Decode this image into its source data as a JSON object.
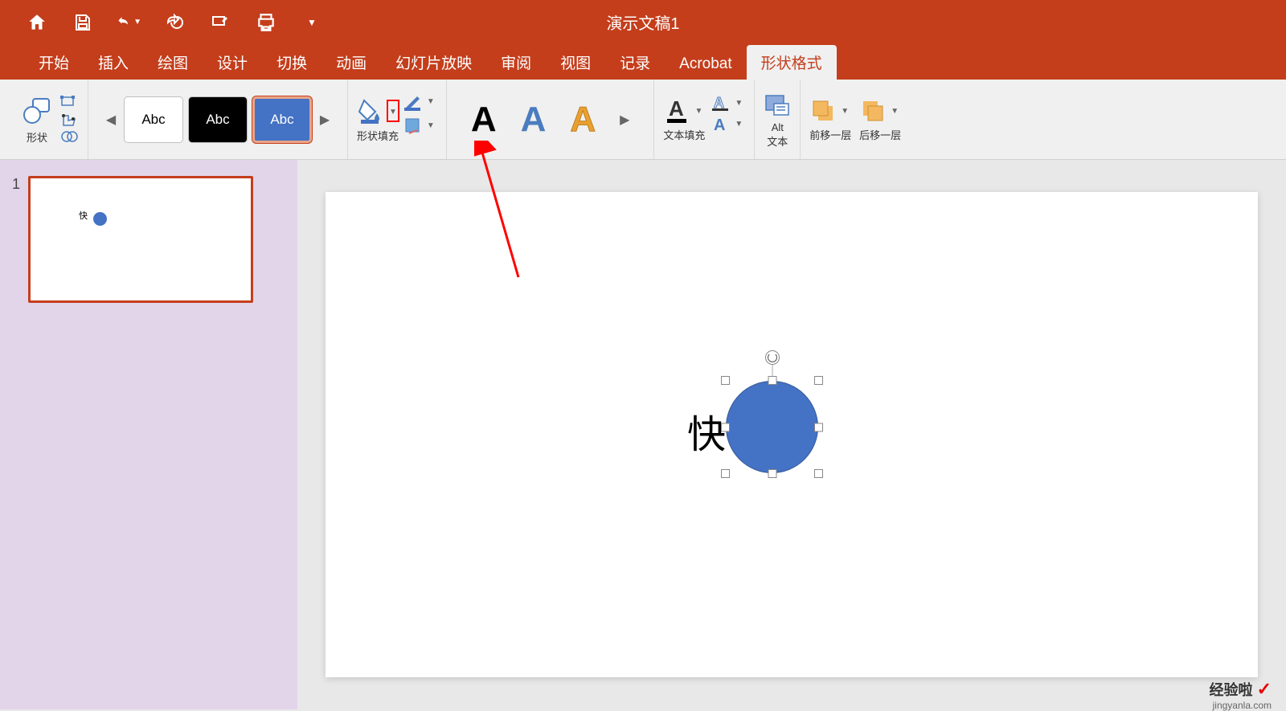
{
  "title": "演示文稿1",
  "tabs": [
    "开始",
    "插入",
    "绘图",
    "设计",
    "切换",
    "动画",
    "幻灯片放映",
    "审阅",
    "视图",
    "记录",
    "Acrobat",
    "形状格式"
  ],
  "activeTab": "形状格式",
  "ribbon": {
    "shapeLabel": "形状",
    "styleItems": [
      "Abc",
      "Abc",
      "Abc"
    ],
    "fillLabel": "形状填充",
    "textFillLabel": "文本填充",
    "altTextLabel1": "Alt",
    "altTextLabel2": "文本",
    "bringForwardLabel": "前移一层",
    "sendBackwardLabel": "后移一层"
  },
  "slides": [
    {
      "number": "1",
      "text": "快"
    }
  ],
  "canvas": {
    "text": "快"
  },
  "watermark": {
    "main": "经验啦",
    "sub": "jingyanla.com"
  }
}
